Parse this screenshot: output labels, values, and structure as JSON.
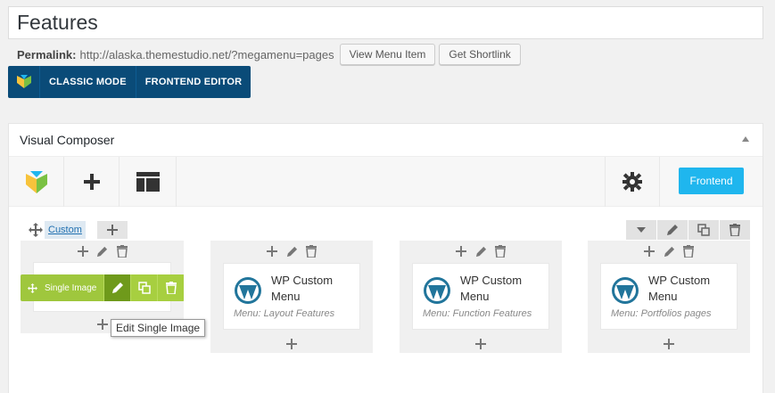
{
  "post": {
    "title": "Features",
    "permalink_label": "Permalink:",
    "permalink_url": "http://alaska.themestudio.net/?megamenu=pages",
    "view_button": "View Menu Item",
    "shortlink_button": "Get Shortlink"
  },
  "mode_bar": {
    "classic_label": "CLASSIC MODE",
    "frontend_label": "FRONTEND EDITOR"
  },
  "vc": {
    "title": "Visual Composer",
    "frontend_button": "Frontend",
    "row_layout_label": "Custom"
  },
  "columns": [
    {
      "element": "Single Image",
      "title": "",
      "subtitle": ""
    },
    {
      "element": "WP Custom Menu",
      "title": "WP Custom\nMenu",
      "subtitle": "Menu: Layout Features"
    },
    {
      "element": "WP Custom Menu",
      "title": "WP Custom\nMenu",
      "subtitle": "Menu: Function Features"
    },
    {
      "element": "WP Custom Menu",
      "title": "WP Custom\nMenu",
      "subtitle": "Menu: Portfolios pages"
    }
  ],
  "single_image_bar": {
    "label": "Single Image"
  },
  "tooltip": "Edit Single Image",
  "colors": {
    "mode_bar": "#0a4b78",
    "frontend_button": "#1fb6ee",
    "element_green": "#9fc73d",
    "wordpress_blue": "#21759b"
  }
}
